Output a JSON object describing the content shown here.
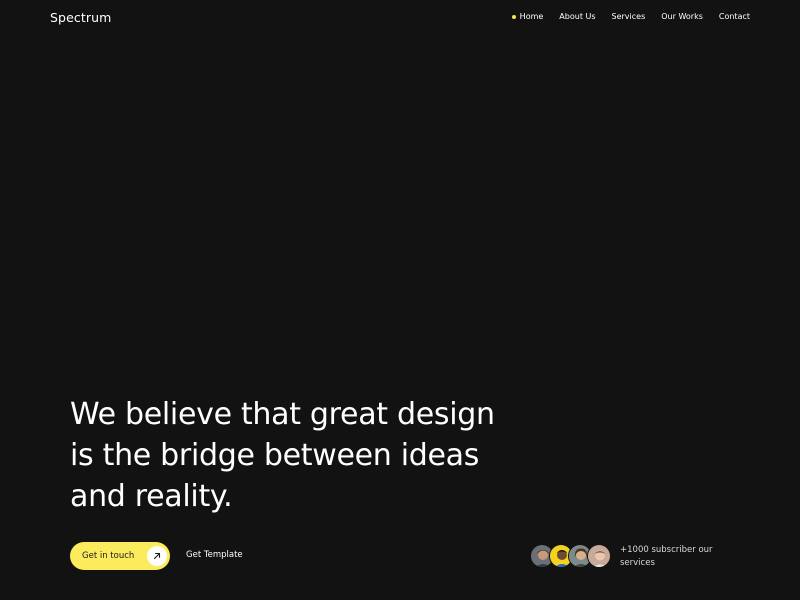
{
  "brand": {
    "name": "Spectrum"
  },
  "nav": {
    "items": [
      {
        "label": "Home",
        "active": true
      },
      {
        "label": "About Us",
        "active": false
      },
      {
        "label": "Services",
        "active": false
      },
      {
        "label": "Our Works",
        "active": false
      },
      {
        "label": "Contact",
        "active": false
      }
    ]
  },
  "hero": {
    "lines": [
      "We believe that great design",
      "is the bridge between ideas",
      "and reality."
    ]
  },
  "actions": {
    "primary_label": "Get in touch",
    "primary_icon": "arrow-up-right-icon",
    "secondary_label": "Get Template"
  },
  "social_proof": {
    "text": "+1000 subscriber our services",
    "avatar_icons": [
      "avatar-1",
      "avatar-2",
      "avatar-3",
      "avatar-4"
    ]
  },
  "colors": {
    "background": "#121212",
    "accent": "#fbeb5d",
    "text": "#ffffff"
  }
}
